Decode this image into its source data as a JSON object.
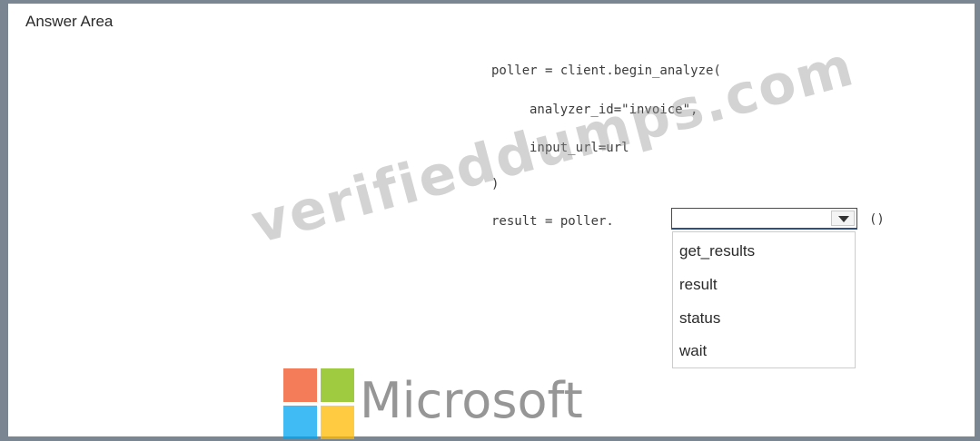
{
  "answer_area": {
    "title": "Answer Area"
  },
  "code": {
    "line1": "poller = client.begin_analyze(",
    "line2": "analyzer_id=\"invoice\",",
    "line3": "input_url=url",
    "line4": ")",
    "line5": "result = poller.",
    "parens": "()"
  },
  "dropdown": {
    "selected": "",
    "options": [
      "get_results",
      "result",
      "status",
      "wait"
    ],
    "border_color": "#2f4f80"
  },
  "watermark": {
    "text": "verifieddumps.com"
  },
  "logo": {
    "text": "Microsoft",
    "icon": "microsoft-logo-icon",
    "colors": [
      "#f25022",
      "#7fba00",
      "#00a4ef",
      "#ffb900"
    ]
  }
}
